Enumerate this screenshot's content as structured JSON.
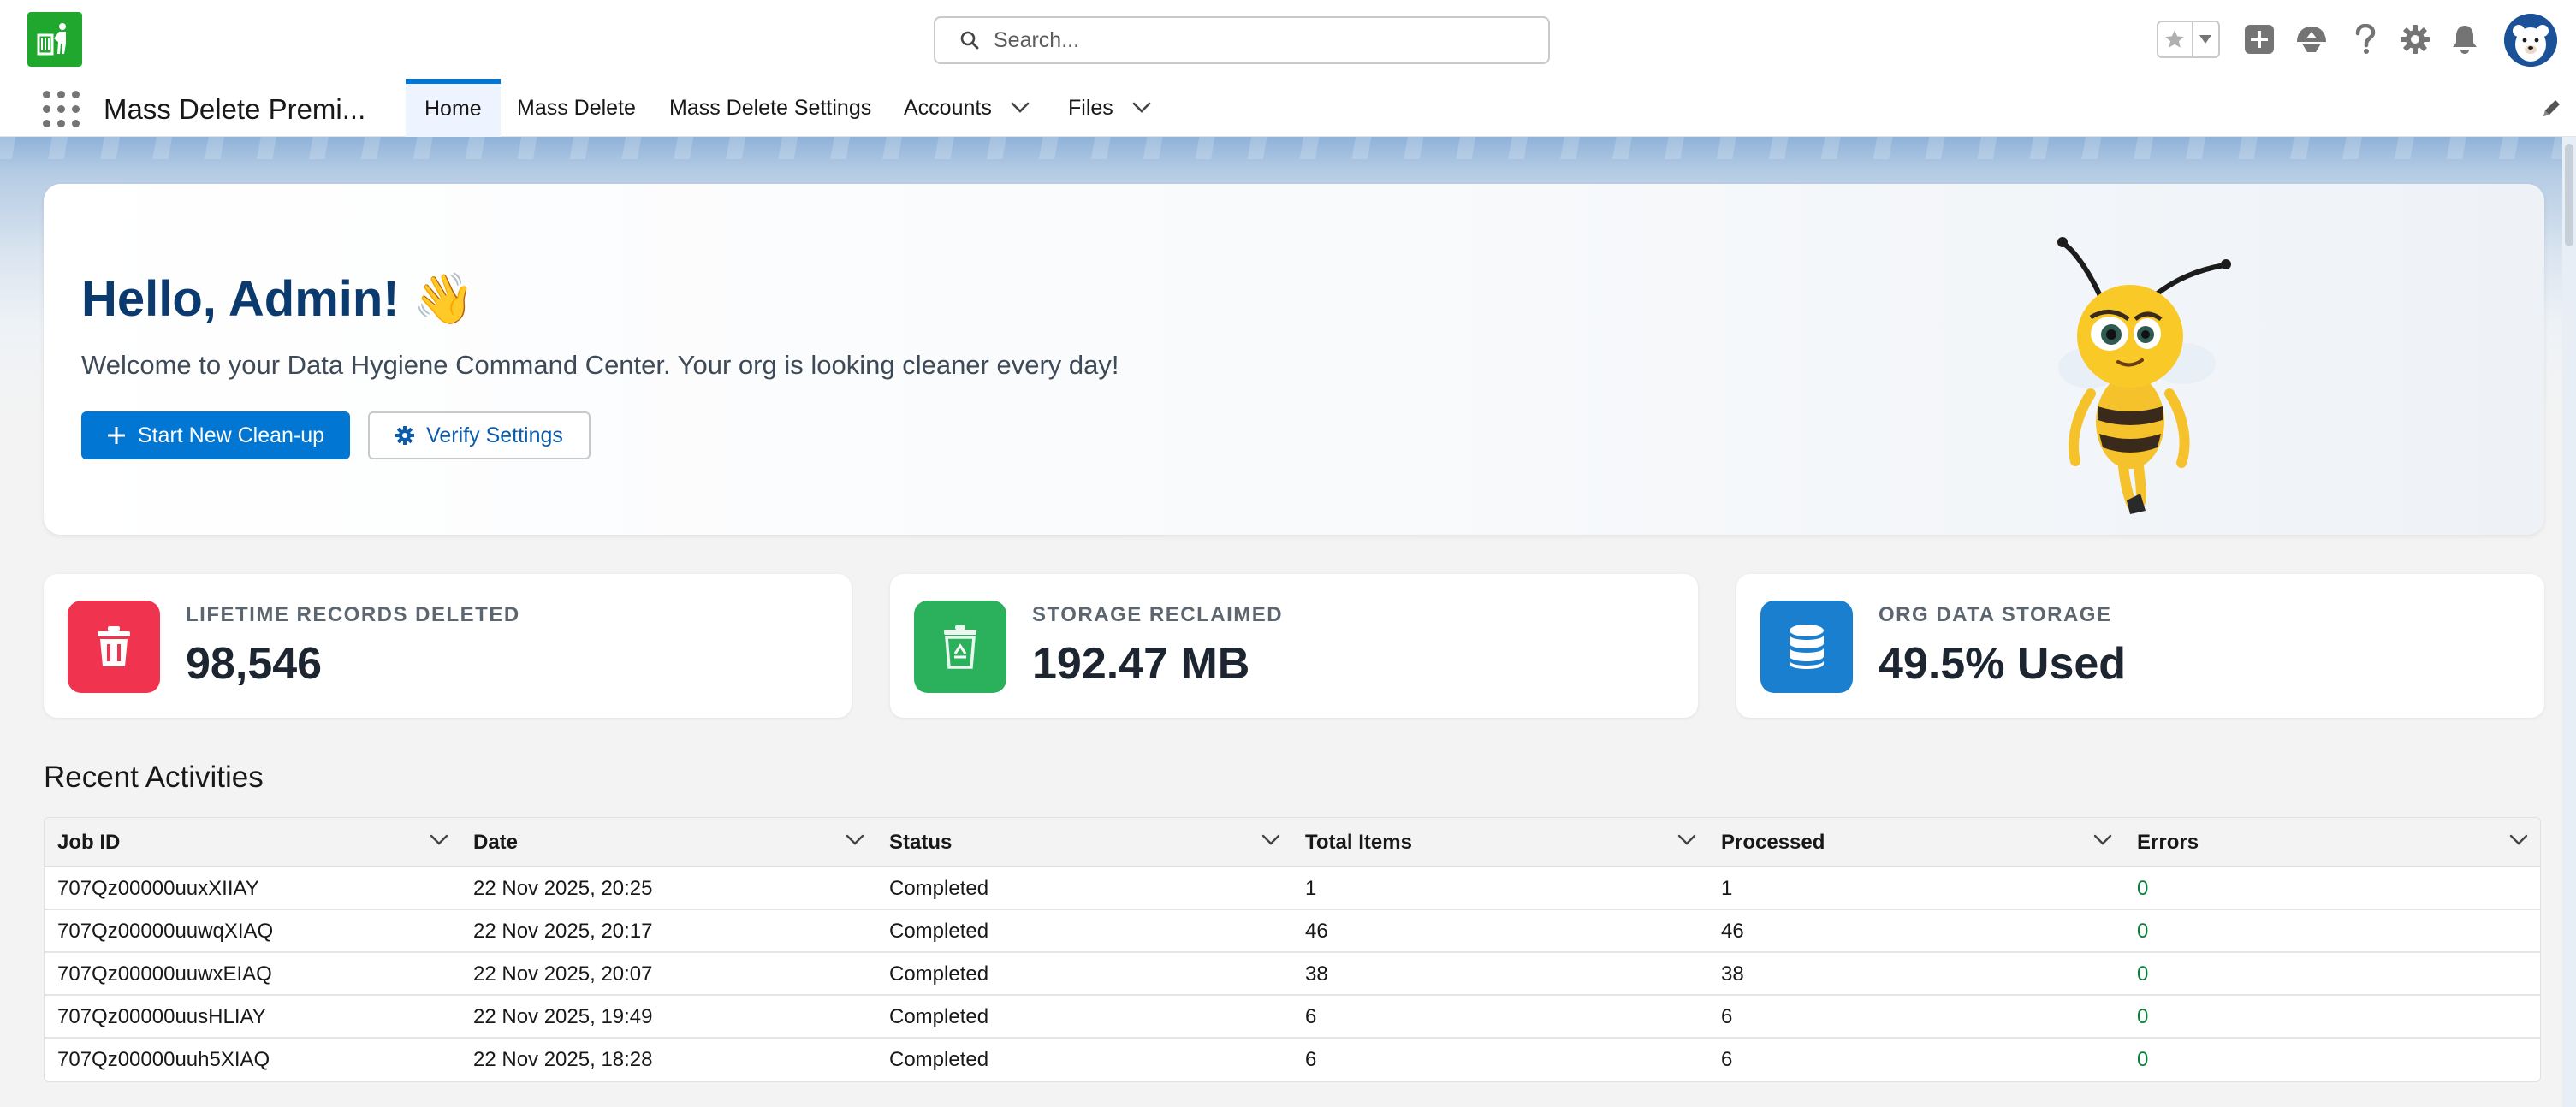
{
  "header": {
    "search_placeholder": "Search..."
  },
  "nav": {
    "app_name": "Mass Delete Premi...",
    "tabs": [
      {
        "label": "Home",
        "active": true
      },
      {
        "label": "Mass Delete"
      },
      {
        "label": "Mass Delete Settings"
      },
      {
        "label": "Accounts",
        "has_menu": true
      },
      {
        "label": "Files",
        "has_menu": true
      }
    ]
  },
  "hero": {
    "greeting": "Hello, Admin! 👋",
    "subtitle": "Welcome to your Data Hygiene Command Center. Your org is looking cleaner every day!",
    "primary_button": "Start New Clean-up",
    "secondary_button": "Verify Settings"
  },
  "stats": [
    {
      "label": "LIFETIME RECORDS DELETED",
      "value": "98,546",
      "icon": "trash-icon",
      "color": "#f0334f"
    },
    {
      "label": "STORAGE RECLAIMED",
      "value": "192.47 MB",
      "icon": "recycle-bin-icon",
      "color": "#2bb05c"
    },
    {
      "label": "ORG DATA STORAGE",
      "value": "49.5% Used",
      "icon": "database-icon",
      "color": "#1b7fd0"
    }
  ],
  "recent": {
    "title": "Recent Activities",
    "columns": [
      "Job ID",
      "Date",
      "Status",
      "Total Items",
      "Processed",
      "Errors"
    ],
    "rows": [
      [
        "707Qz00000uuxXIIAY",
        "22 Nov 2025, 20:25",
        "Completed",
        "1",
        "1",
        "0"
      ],
      [
        "707Qz00000uuwqXIAQ",
        "22 Nov 2025, 20:17",
        "Completed",
        "46",
        "46",
        "0"
      ],
      [
        "707Qz00000uuwxEIAQ",
        "22 Nov 2025, 20:07",
        "Completed",
        "38",
        "38",
        "0"
      ],
      [
        "707Qz00000uusHLIAY",
        "22 Nov 2025, 19:49",
        "Completed",
        "6",
        "6",
        "0"
      ],
      [
        "707Qz00000uuh5XIAQ",
        "22 Nov 2025, 18:28",
        "Completed",
        "6",
        "6",
        "0"
      ]
    ]
  },
  "colors": {
    "brand": "#0176d3",
    "app_logo": "#1fa72e",
    "error_count": "#0a7f3a"
  }
}
